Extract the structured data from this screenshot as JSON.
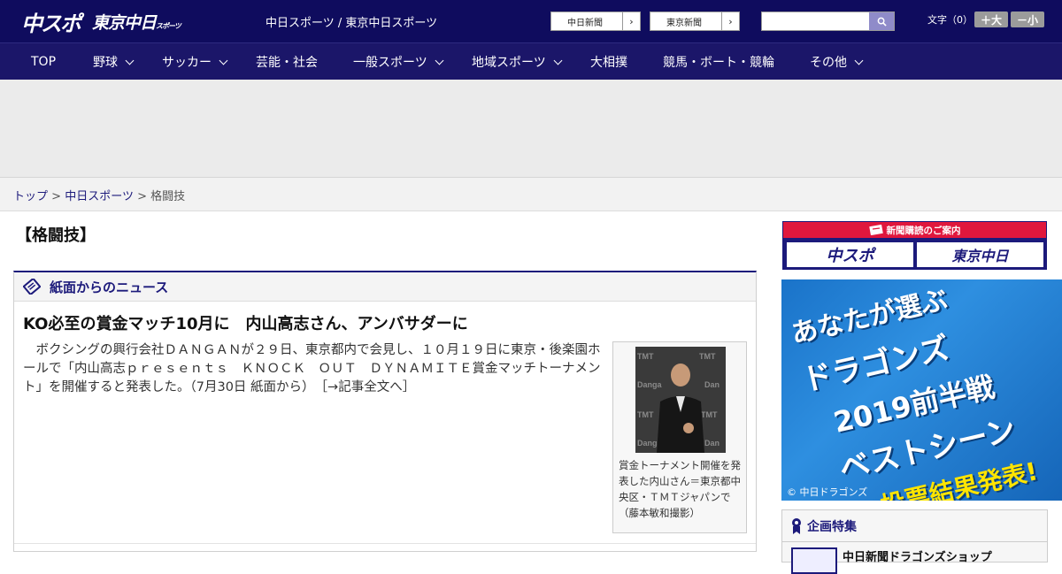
{
  "header": {
    "logo_chuspo": "中スポ",
    "logo_tokyo": "東京中日",
    "logo_tokyo_small": "スポーツ",
    "site_title": "中日スポーツ / 東京中日スポーツ",
    "btn_chunichi": "中日新聞",
    "btn_tokyo": "東京新聞",
    "btn_arrow": "›",
    "search_placeholder": "",
    "fontsize_label": "文字（0）",
    "fontsize_up": "＋大",
    "fontsize_down": "－小"
  },
  "nav": {
    "items": [
      {
        "label": "TOP"
      },
      {
        "label": "野球"
      },
      {
        "label": "サッカー"
      },
      {
        "label": "芸能・社会"
      },
      {
        "label": "一般スポーツ"
      },
      {
        "label": "地域スポーツ"
      },
      {
        "label": "大相撲"
      },
      {
        "label": "競馬・ボート・競輪"
      },
      {
        "label": "その他"
      }
    ]
  },
  "breadcrumb": {
    "top": "トップ",
    "sep": ">",
    "section": "中日スポーツ",
    "current": "格闘技"
  },
  "page": {
    "heading": "【格闘技】"
  },
  "news": {
    "section_title": "紙面からのニュース",
    "headline": "KO必至の賞金マッチ10月に　内山高志さん、アンバサダーに",
    "body": "　ボクシングの興行会社ＤＡＮＧＡＮが２９日、東京都内で会見し、１０月１９日に東京・後楽園ホールで「内山高志ｐｒｅｓｅｎｔｓ　ＫＮＯＣＫ　ＯＵＴ　ＤＹＮＡＭＩＴＥ賞金マッチトーナメント」を開催すると発表した。（7月30日 紙面から）",
    "more": "［→記事全文へ］",
    "caption": "賞金トーナメント開催を発表した内山さん＝東京都中央区・ＴＭＴジャパンで（藤本敏和撮影）"
  },
  "sidebar": {
    "subscription_title": "新聞購読のご案内",
    "sub_logo_left": "中スポ",
    "sub_logo_right": "東京中日",
    "banner": {
      "line1": "あなたが選ぶ",
      "line2": "ドラゴンズ",
      "line3": "2019前半戦",
      "line4": "ベストシーン",
      "line5": "投票結果発表!",
      "copyright": "© 中日ドラゴンズ"
    },
    "feature_title": "企画特集",
    "feature_item": "中日新聞ドラゴンズショップ"
  },
  "colors": {
    "brand_navy": "#0f0c5e",
    "nav_bg": "#1b1669",
    "accent_red": "#e0173d",
    "banner_blue": "#1a73c9"
  }
}
